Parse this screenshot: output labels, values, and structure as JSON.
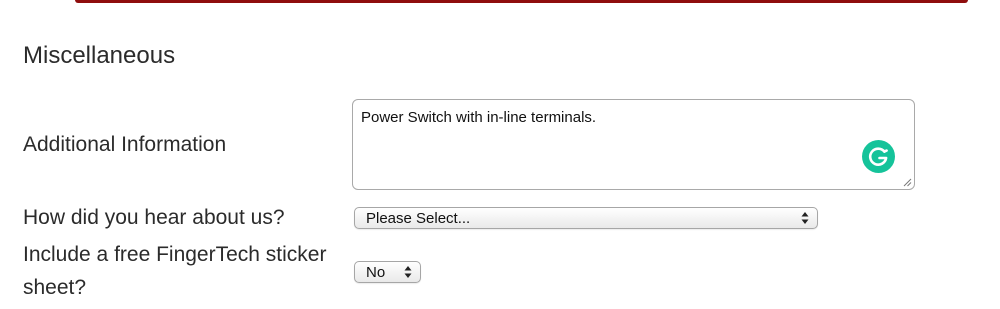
{
  "section": {
    "title": "Miscellaneous"
  },
  "additional_info": {
    "label": "Additional Information",
    "value": "Power Switch with in-line terminals.",
    "assistant_icon": "grammarly-icon"
  },
  "hear_about": {
    "label": "How did you hear about us?",
    "selected": "Please Select..."
  },
  "sticker": {
    "label": "Include a free FingerTech sticker sheet?",
    "selected": "No"
  },
  "colors": {
    "accent_rule": "#8f0d0d",
    "grammarly": "#15c39a",
    "text": "#2b2b2b"
  }
}
